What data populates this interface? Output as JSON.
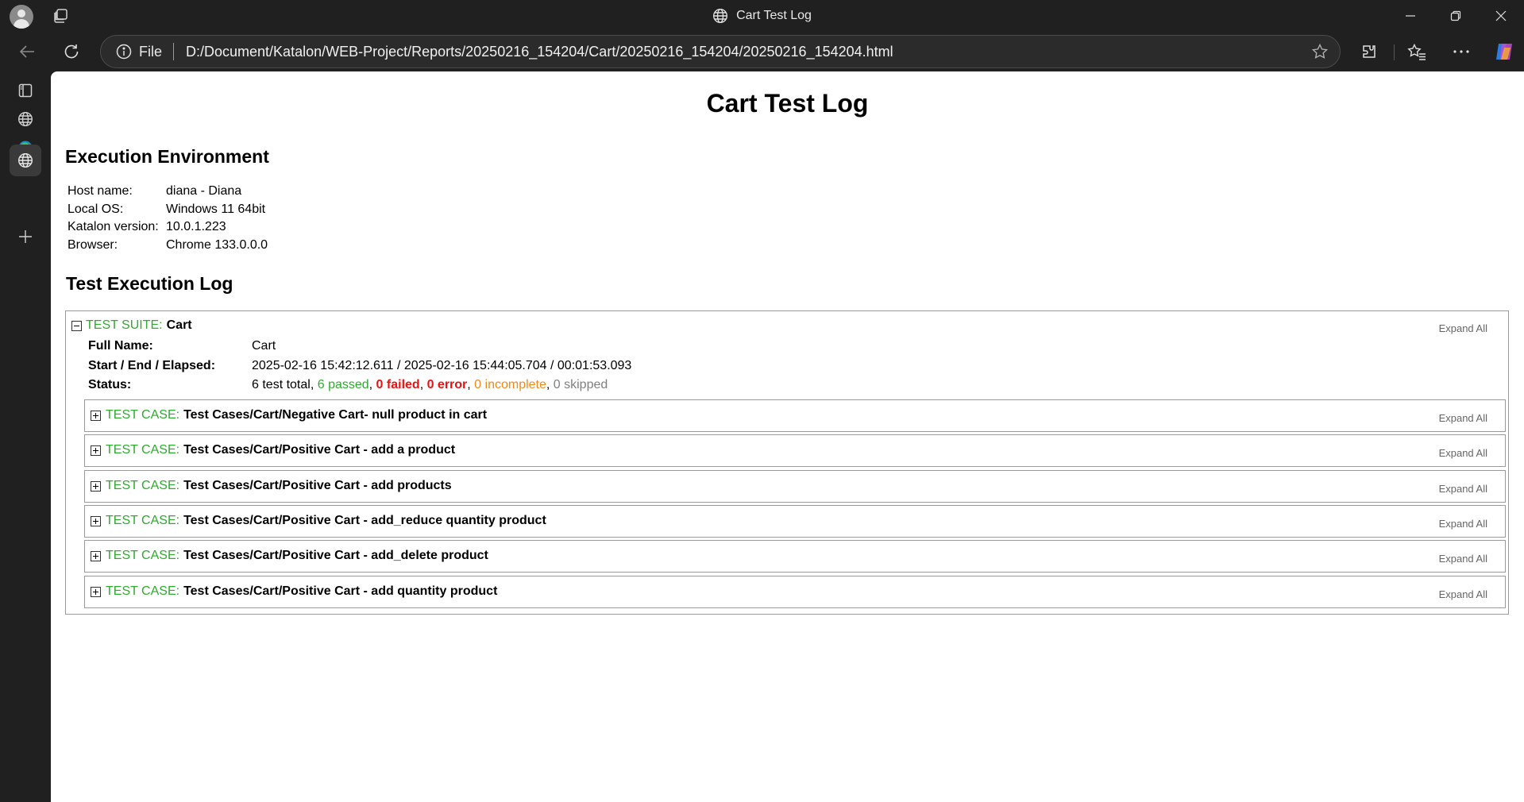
{
  "window": {
    "title": "Cart Test Log"
  },
  "address": {
    "scheme_label": "File",
    "url": "D:/Document/Katalon/WEB-Project/Reports/20250216_154204/Cart/20250216_154204/20250216_154204.html"
  },
  "icons": {
    "profile": "profile-icon",
    "tabs": "tab-actions-icon",
    "globe": "globe-icon",
    "back": "back-arrow-icon",
    "reload": "reload-icon",
    "info": "info-icon",
    "favorite": "star-icon",
    "extensions": "extensions-icon",
    "favorites": "favorites-icon",
    "more": "more-icon",
    "copilot": "copilot-icon",
    "minimize": "minimize-icon",
    "maximize": "restore-icon",
    "close": "close-icon",
    "sidebar": [
      "vertical-tabs-icon",
      "globe-icon",
      "edge-icon",
      "globe-icon",
      "plus-icon"
    ]
  },
  "report": {
    "title": "Cart Test Log",
    "env_heading": "Execution Environment",
    "env": [
      {
        "key": "Host name:",
        "value": "diana - Diana"
      },
      {
        "key": "Local OS:",
        "value": "Windows 11 64bit"
      },
      {
        "key": "Katalon version:",
        "value": "10.0.1.223"
      },
      {
        "key": "Browser:",
        "value": "Chrome 133.0.0.0"
      }
    ],
    "log_heading": "Test Execution Log",
    "suite": {
      "label": "TEST SUITE:",
      "name": "Cart",
      "expand_all": "Expand All",
      "full_name_label": "Full Name:",
      "full_name": "Cart",
      "time_label": "Start / End / Elapsed:",
      "time_value": "2025-02-16 15:42:12.611 / 2025-02-16 15:44:05.704 / 00:01:53.093",
      "status_label": "Status:",
      "status": {
        "total": "6 test total",
        "passed": "6 passed",
        "failed": "0 failed",
        "error": "0 error",
        "incomplete": "0 incomplete",
        "skipped": "0 skipped",
        "sep": ", "
      }
    },
    "case_label": "TEST CASE:",
    "case_expand_all": "Expand All",
    "cases": [
      {
        "name": "Test Cases/Cart/Negative Cart- null product in cart"
      },
      {
        "name": "Test Cases/Cart/Positive Cart - add a product"
      },
      {
        "name": "Test Cases/Cart/Positive Cart - add products"
      },
      {
        "name": "Test Cases/Cart/Positive Cart - add_reduce quantity product"
      },
      {
        "name": "Test Cases/Cart/Positive Cart - add_delete product"
      },
      {
        "name": "Test Cases/Cart/Positive Cart - add quantity product"
      }
    ]
  },
  "colors": {
    "pass": "#2eaa2e",
    "fail": "#ee1111",
    "incomplete": "#f08a1a",
    "skipped": "#808080"
  }
}
